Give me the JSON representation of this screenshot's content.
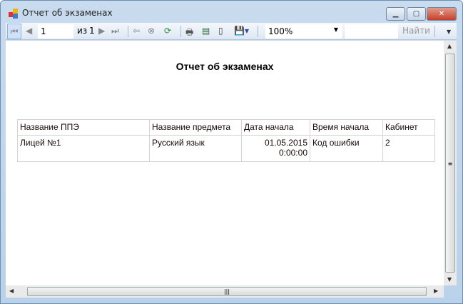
{
  "window": {
    "title": "Отчет об экзаменах"
  },
  "toolbar": {
    "page_value": "1",
    "of_label": "из",
    "total_pages": "1",
    "zoom": "100%",
    "search_value": "",
    "find_label": "Найти"
  },
  "report": {
    "title": "Отчет об экзаменах",
    "columns": [
      "Название ППЭ",
      "Название предмета",
      "Дата начала",
      "Время начала",
      "Кабинет"
    ],
    "rows": [
      [
        "Лицей №1",
        "Русский язык",
        "01.05.2015 0:00:00",
        "Код ошибки",
        "2"
      ]
    ]
  }
}
